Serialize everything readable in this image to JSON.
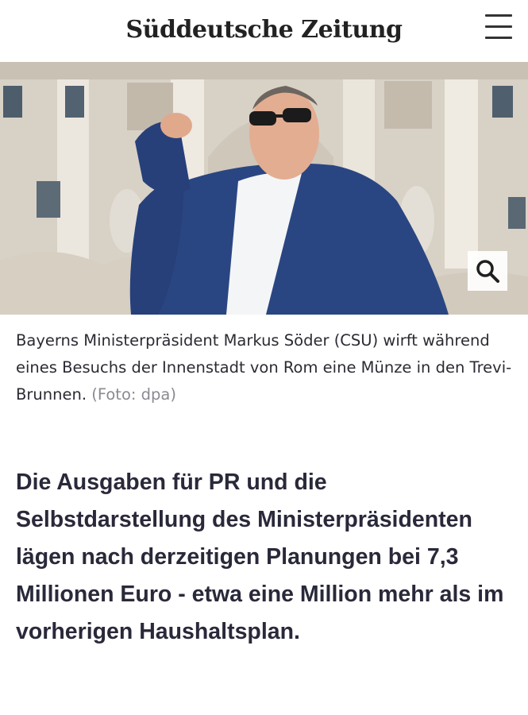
{
  "header": {
    "logo_text": "Süddeutsche Zeitung",
    "menu_icon": "hamburger-menu-icon"
  },
  "photo": {
    "zoom_icon": "magnifier-icon"
  },
  "caption": {
    "text": "Bayerns Ministerpräsident Markus Söder (CSU) wirft während eines Besuchs der Innenstadt von Rom eine Münze in den Trevi-Brunnen.",
    "credit": "(Foto: dpa)"
  },
  "article": {
    "lead": "Die Ausgaben für PR und die Selbstdarstellung des Ministerpräsidenten lägen nach derzeitigen Planungen bei 7,3 Millionen Euro - etwa eine Million mehr als im vorherigen Haushaltsplan."
  },
  "colors": {
    "text": "#29293a",
    "credit": "#8a8a92",
    "suit": "#27407a"
  }
}
